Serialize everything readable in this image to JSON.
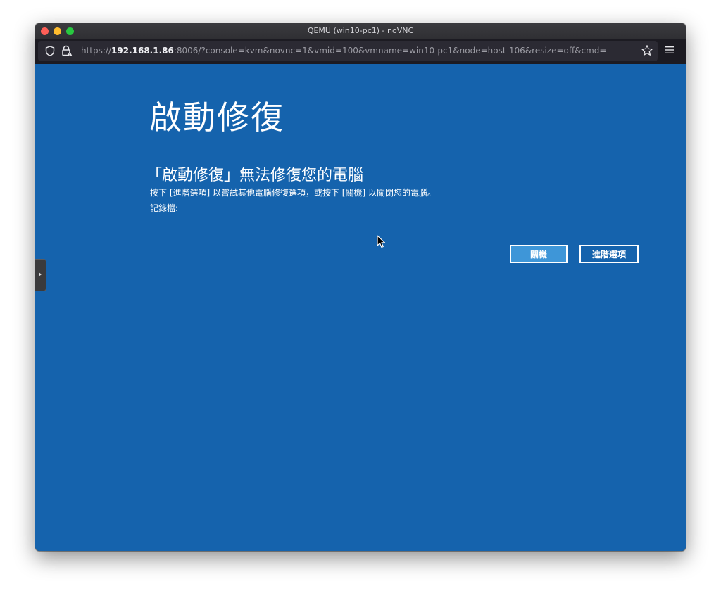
{
  "window": {
    "title": "QEMU (win10-pc1) - noVNC"
  },
  "urlbar": {
    "scheme": "https://",
    "host": "192.168.1.86",
    "rest": ":8006/?console=kvm&novnc=1&vmid=100&vmname=win10-pc1&node=host-106&resize=off&cmd="
  },
  "icons": {
    "shield": "shield-icon",
    "lock": "lock-icon",
    "star": "star-icon",
    "menu": "hamburger-menu-icon",
    "cursor": "mouse-cursor-icon"
  },
  "screen": {
    "background": "#1563ad",
    "title": "啟動修復",
    "subtitle": "「啟動修復」無法修復您的電腦",
    "description": "按下 [進階選項] 以嘗試其他電腦修復選項，或按下 [關機] 以關閉您的電腦。",
    "log_label": "記錄檔:",
    "shutdown_label": "關機",
    "advanced_label": "進階選項"
  },
  "colors": {
    "vnc_blue": "#1563ad",
    "shutdown_button": "#3e96d8",
    "traffic_close": "#fe5f57",
    "traffic_min": "#febc2e",
    "traffic_max": "#28c840"
  }
}
